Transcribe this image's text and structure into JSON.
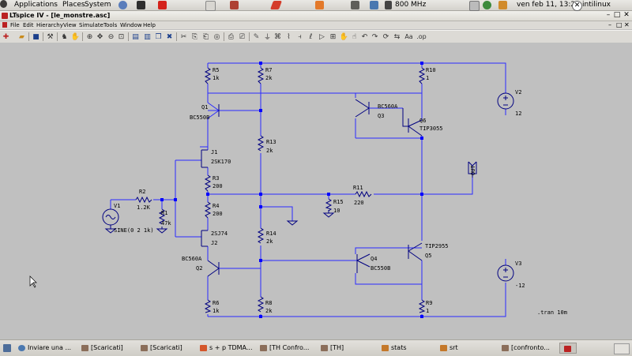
{
  "top_panel": {
    "applications": "Applications",
    "places": "Places",
    "system": "System",
    "cpu_freq": "800 MHz",
    "clock": "ven feb 11, 13:21",
    "user": "intilinux"
  },
  "window": {
    "title": "LTspice IV - [le_monstre.asc]",
    "controls": {
      "minimize": "–",
      "maximize": "□",
      "close": "✕"
    }
  },
  "menu": [
    "File",
    "Edit",
    "Hierarchy",
    "View",
    "Simulate",
    "Tools",
    "Window",
    "Help"
  ],
  "schematic": {
    "components": {
      "R5": {
        "name": "R5",
        "value": "1k"
      },
      "R7": {
        "name": "R7",
        "value": "2k"
      },
      "R10": {
        "name": "R10",
        "value": "1"
      },
      "V2": {
        "name": "V2",
        "value": "12"
      },
      "Q1": {
        "name": "Q1",
        "model": "BC550B"
      },
      "Q3": {
        "name": "Q3",
        "model": "BC560A"
      },
      "Q6": {
        "name": "Q6",
        "model": "TIP3055"
      },
      "J1": {
        "name": "J1",
        "model": "2SK170"
      },
      "R13": {
        "name": "R13",
        "value": "2k"
      },
      "R3": {
        "name": "R3",
        "value": "200"
      },
      "R2": {
        "name": "R2",
        "value": "1.2K"
      },
      "R1": {
        "name": "R1",
        "value": "47k"
      },
      "V1": {
        "name": "V1",
        "value": "SINE(0 2 1k)"
      },
      "R11": {
        "name": "R11",
        "value": "220"
      },
      "R15": {
        "name": "R15",
        "value": "10"
      },
      "OUT": {
        "name": "OUT"
      },
      "R4": {
        "name": "R4",
        "value": "200"
      },
      "J2": {
        "name": "J2",
        "model": "2SJ74"
      },
      "R14": {
        "name": "R14",
        "value": "2k"
      },
      "Q2": {
        "name": "Q2",
        "model": "BC560A"
      },
      "Q4": {
        "name": "Q4",
        "model": "BC550B"
      },
      "Q5": {
        "name": "Q5",
        "model": "TIP2955"
      },
      "V3": {
        "name": "V3",
        "value": "-12"
      },
      "R6": {
        "name": "R6",
        "value": "1k"
      },
      "R8": {
        "name": "R8",
        "value": "2k"
      },
      "R9": {
        "name": "R9",
        "value": "1"
      }
    },
    "directive": ".tran 10m"
  },
  "taskbar": [
    {
      "label": "Inviare una ..."
    },
    {
      "label": "[Scaricati]"
    },
    {
      "label": "[Scaricati]"
    },
    {
      "label": "s + p TDMA..."
    },
    {
      "label": "[TH Confro..."
    },
    {
      "label": "[TH]"
    },
    {
      "label": "stats"
    },
    {
      "label": "srt"
    },
    {
      "label": "[confronto..."
    }
  ],
  "colors": {
    "wire": "#2a2aff",
    "component": "#000080",
    "junction": "#0000ff",
    "background": "#c0c0c0"
  }
}
